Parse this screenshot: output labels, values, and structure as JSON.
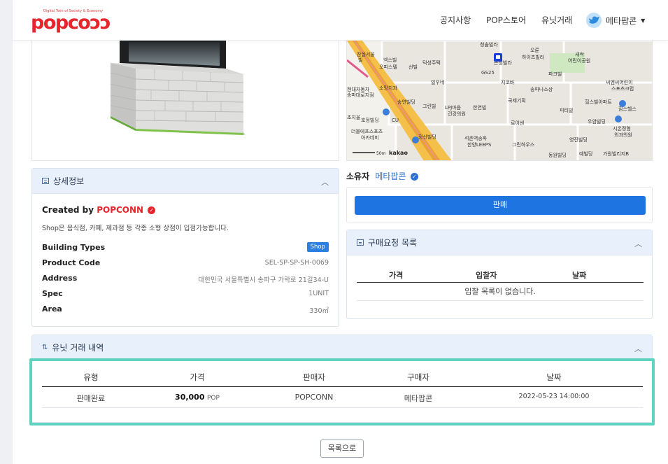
{
  "header": {
    "logo_tagline": "Digital Twin of Society & Economy",
    "logo_text": "popcoɔɔ",
    "nav": [
      "공지사항",
      "POP스토어",
      "유닛거래"
    ],
    "user_name": "메타팝콘"
  },
  "map": {
    "labels": [
      "잠실서울",
      "넥스빌",
      "덕성주택",
      "청솔빌라",
      "오륜",
      "하이츠빌라",
      "새싹",
      "어린이공원",
      "GS25",
      "지코바",
      "파크빌",
      "일우네",
      "송파나스상",
      "씨엠씨어린이",
      "스포츠크럽",
      "소망치과",
      "국제기획",
      "힐스빌아파트",
      "송연빌딩",
      "그린빌",
      "LPJ마음",
      "한연빌",
      "건강의원",
      "피티빌",
      "짐스헬스",
      "호정빌딩",
      "CU",
      "로이센",
      "우암빌딩",
      "더블에프스포츠",
      "아카데미",
      "정신빌딩",
      "석촌역송파",
      "한양LEEPS",
      "그린하우스",
      "영진빌딩",
      "시온정형",
      "외과의원",
      "동원빌딩",
      "예빌딩",
      "가원빌리지B",
      "현대자동차",
      "송파대로지점",
      "초지울",
      "오피스텔",
      "빌",
      "선빌",
      "은성빌라"
    ],
    "scale_label": "50m",
    "provider": "kakao"
  },
  "detail": {
    "title": "상세정보",
    "created_by_prefix": "Created by",
    "creator": "POPCONN",
    "description": "Shop은 음식점, 카페, 제과점 등 각종 소형 상점이 입점가능합니다.",
    "specs": [
      {
        "label": "Building Types",
        "value": "Shop"
      },
      {
        "label": "Product Code",
        "value": "SEL-SP-SP-SH-0069"
      },
      {
        "label": "Address",
        "value": "대한민국 서울특별시 송파구 가락로 21길34-U"
      },
      {
        "label": "Spec",
        "value": "1UNIT"
      },
      {
        "label": "Area",
        "value": "330㎡"
      }
    ]
  },
  "owner": {
    "label": "소유자",
    "name": "메타팝콘"
  },
  "sell": {
    "button_label": "판매"
  },
  "bids": {
    "title": "구매요청 목록",
    "columns": [
      "가격",
      "입찰자",
      "날짜"
    ],
    "empty_text": "입찰 목록이 없습니다."
  },
  "history": {
    "title": "유닛 거래 내역",
    "columns": [
      "유형",
      "가격",
      "판매자",
      "구매자",
      "날짜"
    ],
    "rows": [
      {
        "type": "판매완료",
        "price": "30,000",
        "unit": "POP",
        "seller": "POPCONN",
        "buyer": "메타팝콘",
        "date": "2022-05-23 14:00:00"
      }
    ]
  },
  "back_button": "목록으로",
  "colors": {
    "brand": "#e5272d",
    "accent": "#1e74e0",
    "highlight": "#5fd3c0"
  }
}
